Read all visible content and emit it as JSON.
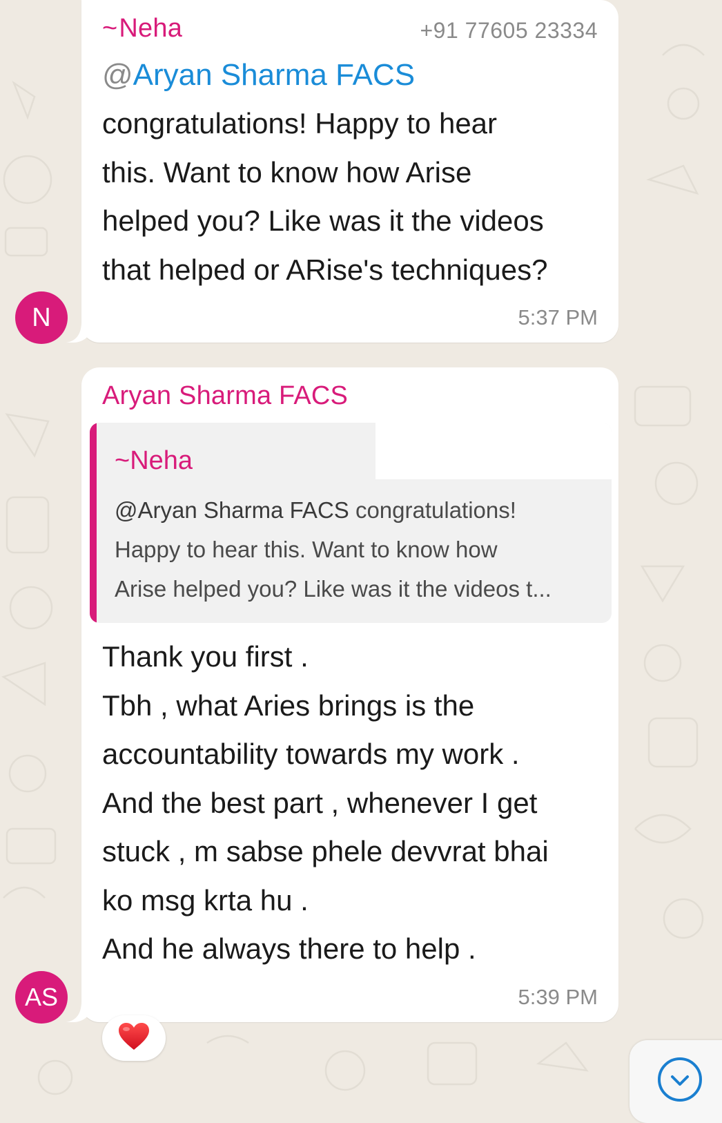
{
  "messages": [
    {
      "sender": "Neha",
      "sender_prefix": "~",
      "phone": "+91 77605 23334",
      "mention_at": "@",
      "mention_name": "Aryan Sharma FACS",
      "lines": [
        "congratulations! Happy to hear",
        "this. Want to know how Arise",
        "helped you? Like was it the videos",
        "that helped or ARise's techniques?"
      ],
      "time": "5:37 PM",
      "avatar": "N"
    },
    {
      "sender": "Aryan Sharma FACS",
      "quote": {
        "author_prefix": "~",
        "author": "Neha",
        "mention": "@Aryan Sharma FACS",
        "line1_rest": " congratulations!",
        "line2": "Happy to hear this. Want to know how",
        "line3": "Arise helped you? Like was it the videos t..."
      },
      "lines": [
        "Thank you first .",
        "Tbh , what Aries brings is the",
        "accountability towards my work .",
        "And the best part , whenever I get",
        "stuck , m sabse phele devvrat bhai",
        "ko msg krta hu .",
        "And he always there to help ."
      ],
      "time": "5:39 PM",
      "avatar": "AS",
      "reaction": "❤️"
    }
  ],
  "colors": {
    "sender": "#d81b7a",
    "mention": "#1a8cd8",
    "background": "#efeae2",
    "bubble": "#ffffff"
  },
  "icons": {
    "reaction": "heart-icon",
    "scroll": "chevron-down-circle-icon"
  }
}
